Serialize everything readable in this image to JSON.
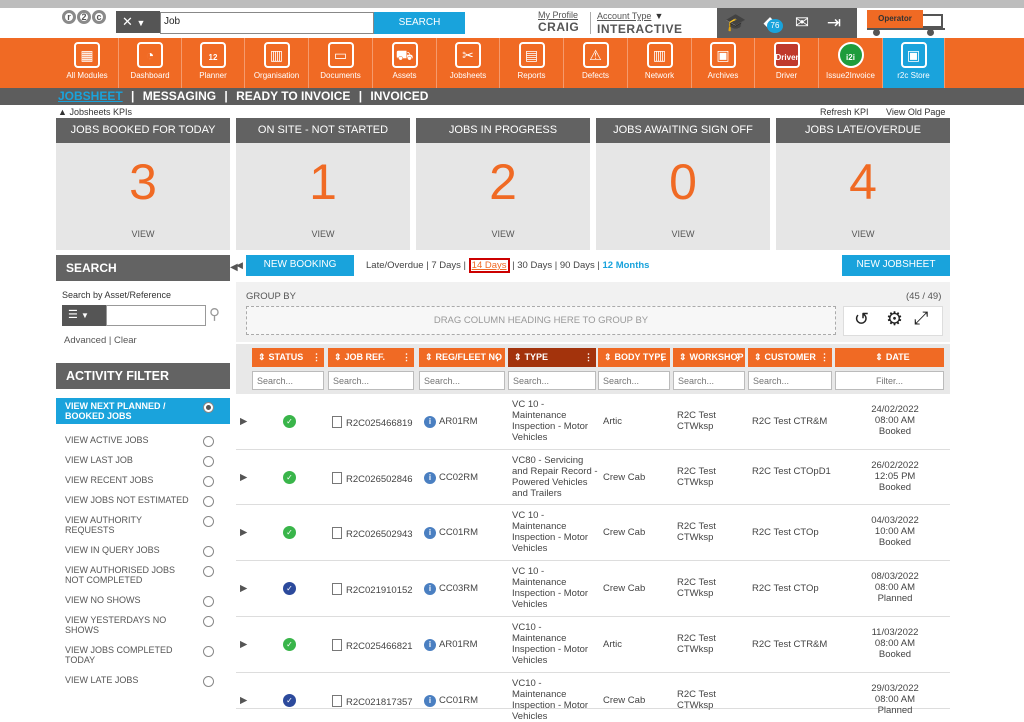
{
  "header": {
    "search_value": "Job",
    "search_button": "SEARCH",
    "my_profile": "My Profile",
    "username": "CRAIG",
    "account_type_label": "Account Type",
    "account_type": "INTERACTIVE",
    "notification_count": "76",
    "operator_label": "Operator"
  },
  "nav": [
    {
      "label": "All Modules",
      "icon": "grid-icon"
    },
    {
      "label": "Dashboard",
      "icon": "gauge-icon"
    },
    {
      "label": "Planner",
      "icon": "calendar-icon",
      "badge": "12"
    },
    {
      "label": "Organisation",
      "icon": "building-icon"
    },
    {
      "label": "Documents",
      "icon": "folder-icon"
    },
    {
      "label": "Assets",
      "icon": "truck-icon"
    },
    {
      "label": "Jobsheets",
      "icon": "tools-icon"
    },
    {
      "label": "Reports",
      "icon": "clipboard-icon"
    },
    {
      "label": "Defects",
      "icon": "warning-icon"
    },
    {
      "label": "Network",
      "icon": "book-icon"
    },
    {
      "label": "Archives",
      "icon": "archive-icon"
    },
    {
      "label": "Driver",
      "icon": "driver-icon",
      "badge": "Driver"
    },
    {
      "label": "Issue2Invoice",
      "icon": "i2i-icon",
      "badge": "i2i"
    },
    {
      "label": "r2c Store",
      "icon": "store-icon"
    }
  ],
  "subnav": {
    "jobsheet": "JOBSHEET",
    "messaging": "MESSAGING",
    "ready_to_invoice": "READY TO INVOICE",
    "invoiced": "INVOICED",
    "sep": "|"
  },
  "kpi_bar": {
    "label": "Jobsheets KPIs",
    "refresh": "Refresh KPI",
    "old_page": "View Old Page"
  },
  "kpis": [
    {
      "title": "JOBS BOOKED FOR TODAY",
      "value": "3",
      "view": "VIEW"
    },
    {
      "title": "ON SITE - NOT STARTED",
      "value": "1",
      "view": "VIEW"
    },
    {
      "title": "JOBS IN PROGRESS",
      "value": "2",
      "view": "VIEW"
    },
    {
      "title": "JOBS AWAITING SIGN OFF",
      "value": "0",
      "view": "VIEW"
    },
    {
      "title": "JOBS LATE/OVERDUE",
      "value": "4",
      "view": "VIEW"
    }
  ],
  "search_panel": {
    "title": "SEARCH",
    "label": "Search by Asset/Reference",
    "advanced": "Advanced",
    "clear": "Clear",
    "sep": "|"
  },
  "activity_filter": {
    "title": "ACTIVITY FILTER",
    "items": [
      "VIEW NEXT PLANNED / BOOKED JOBS",
      "VIEW ACTIVE JOBS",
      "VIEW LAST JOB",
      "VIEW RECENT JOBS",
      "VIEW JOBS NOT ESTIMATED",
      "VIEW AUTHORITY REQUESTS",
      "VIEW IN QUERY JOBS",
      "VIEW AUTHORISED JOBS NOT COMPLETED",
      "VIEW NO SHOWS",
      "VIEW YESTERDAYS NO SHOWS",
      "VIEW JOBS COMPLETED TODAY",
      "VIEW LATE JOBS"
    ]
  },
  "toolbar": {
    "new_booking": "NEW BOOKING",
    "late_overdue": "Late/Overdue",
    "d7": "7 Days",
    "d14": "14 Days",
    "d30": "30 Days",
    "d90": "90 Days",
    "m12": "12 Months",
    "sep": "|",
    "new_jobsheet": "NEW JOBSHEET"
  },
  "grid": {
    "group_by": "GROUP BY",
    "count": "(45 / 49)",
    "drag_hint": "DRAG COLUMN HEADING HERE TO GROUP BY",
    "columns": [
      "STATUS",
      "JOB REF.",
      "REG/FLEET NO",
      "TYPE",
      "BODY TYPE",
      "WORKSHOP",
      "CUSTOMER",
      "DATE"
    ],
    "search_placeholder": "Search...",
    "filter_placeholder": "Filter...",
    "rows": [
      {
        "status": "booked",
        "ref": "R2C025466819",
        "reg": "AR01RM",
        "type": "VC 10 - Maintenance Inspection - Motor Vehicles",
        "body": "Artic",
        "workshop": "R2C Test CTWksp",
        "customer": "R2C Test CTR&M",
        "date": "24/02/2022",
        "time": "08:00 AM",
        "state": "Booked"
      },
      {
        "status": "booked",
        "ref": "R2C026502846",
        "reg": "CC02RM",
        "type": "VC80 - Servicing and Repair Record - Powered Vehicles and Trailers",
        "body": "Crew Cab",
        "workshop": "R2C Test CTWksp",
        "customer": "R2C Test CTOpD1",
        "date": "26/02/2022",
        "time": "12:05 PM",
        "state": "Booked"
      },
      {
        "status": "booked",
        "ref": "R2C026502943",
        "reg": "CC01RM",
        "type": "VC 10 - Maintenance Inspection - Motor Vehicles",
        "body": "Crew Cab",
        "workshop": "R2C Test CTWksp",
        "customer": "R2C Test CTOp",
        "date": "04/03/2022",
        "time": "10:00 AM",
        "state": "Booked"
      },
      {
        "status": "planned",
        "ref": "R2C021910152",
        "reg": "CC03RM",
        "type": "VC 10 - Maintenance Inspection - Motor Vehicles",
        "body": "Crew Cab",
        "workshop": "R2C Test CTWksp",
        "customer": "R2C Test CTOp",
        "date": "08/03/2022",
        "time": "08:00 AM",
        "state": "Planned"
      },
      {
        "status": "booked",
        "ref": "R2C025466821",
        "reg": "AR01RM",
        "type": "VC10 - Maintenance Inspection - Motor Vehicles",
        "body": "Artic",
        "workshop": "R2C Test CTWksp",
        "customer": "R2C Test CTR&M",
        "date": "11/03/2022",
        "time": "08:00 AM",
        "state": "Booked"
      },
      {
        "status": "planned",
        "ref": "R2C021817357",
        "reg": "CC01RM",
        "type": "VC10 - Maintenance Inspection - Motor Vehicles",
        "body": "Crew Cab",
        "workshop": "R2C Test CTWksp",
        "customer": "",
        "date": "29/03/2022",
        "time": "08:00 AM",
        "state": "Planned"
      }
    ]
  }
}
